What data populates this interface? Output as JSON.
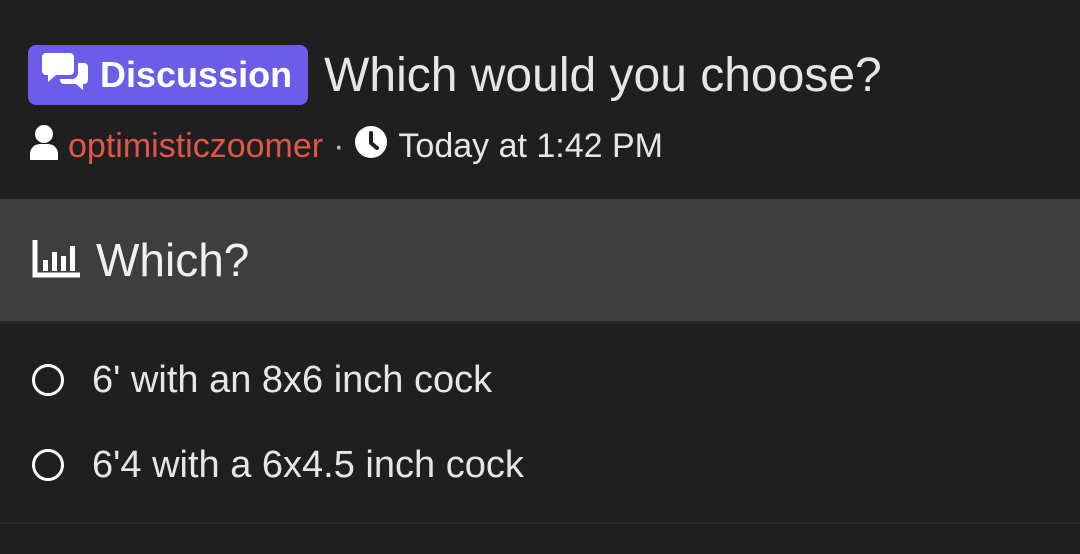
{
  "thread": {
    "badge_label": "Discussion",
    "badge_icon": "comments-icon",
    "badge_color": "#6c5ce7",
    "title": "Which would you choose?",
    "author_icon": "user-icon",
    "author": "optimisticzoomer",
    "author_color": "#e0574a",
    "separator": "·",
    "time_icon": "clock-icon",
    "timestamp": "Today at 1:42 PM"
  },
  "poll": {
    "icon": "poll-chart-icon",
    "question": "Which?",
    "options": [
      {
        "label": "6' with an 8x6 inch cock",
        "selected": false
      },
      {
        "label": "6'4 with a 6x4.5 inch cock",
        "selected": false
      }
    ]
  }
}
